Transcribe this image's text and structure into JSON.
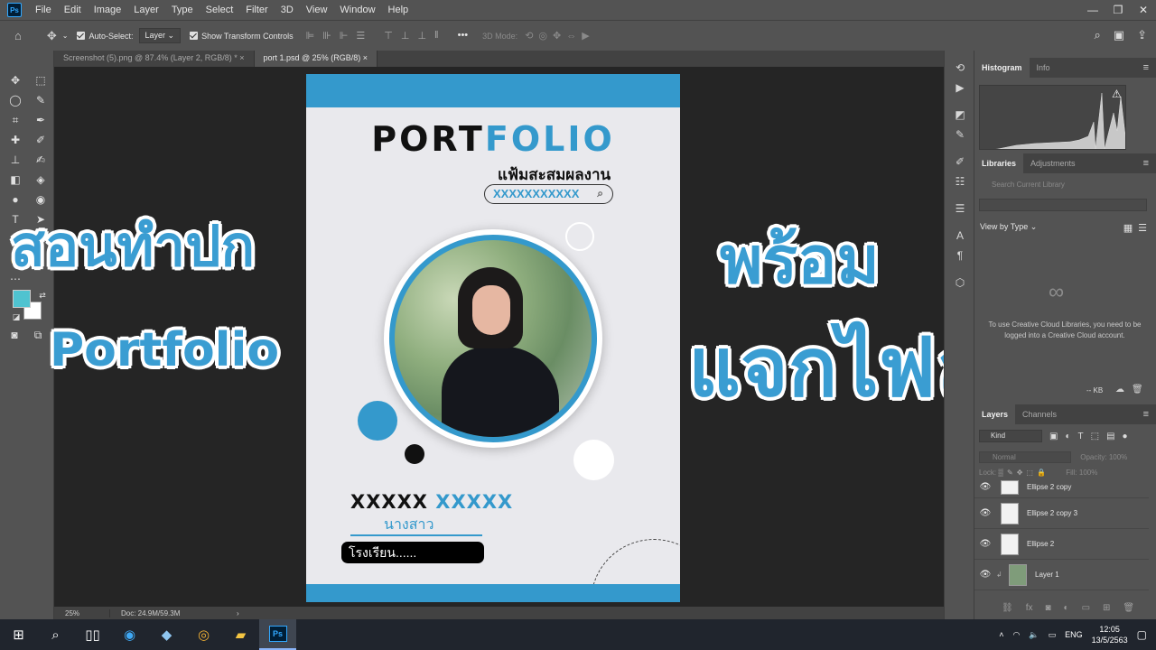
{
  "app": {
    "logo": "Ps"
  },
  "menu": [
    "File",
    "Edit",
    "Image",
    "Layer",
    "Type",
    "Select",
    "Filter",
    "3D",
    "View",
    "Window",
    "Help"
  ],
  "window_controls": {
    "minimize": "—",
    "restore": "❐",
    "close": "✕"
  },
  "options": {
    "auto_select_label": "Auto-Select:",
    "auto_select_value": "Layer",
    "transform_label": "Show Transform Controls",
    "mode3d_label": "3D Mode:"
  },
  "tabs": [
    {
      "label": "Screenshot (5).png @ 87.4% (Layer 2, RGB/8) *",
      "close": "×"
    },
    {
      "label": "port 1.psd @ 25% (RGB/8)",
      "close": "×"
    }
  ],
  "colors": {
    "foreground": "#4fc3d0",
    "background": "#ffffff",
    "accent": "#3499cc"
  },
  "document": {
    "title_part1": "PORT",
    "title_part2": "FOLIO",
    "subtitle": "แฟ้มสะสมผลงาน",
    "search_text": "XXXXXXXXXXX",
    "name_part1": "XXXXX",
    "name_part2": "XXXXX",
    "title_thai": "นางสาว",
    "school": "โรงเรียน......"
  },
  "overlay": {
    "line1": "สอนทำปก",
    "line2": "Portfolio",
    "line3": "พร้อม",
    "line4": "แจกไฟล์"
  },
  "status": {
    "zoom": "25%",
    "doc_size": "Doc: 24.9M/59.3M",
    "arrow": "›"
  },
  "panels": {
    "histogram_tabs": [
      "Histogram",
      "Info"
    ],
    "library_tabs": [
      "Libraries",
      "Adjustments"
    ],
    "library_search_placeholder": "Search Current Library",
    "view_by_type": "View by Type",
    "cc_message": "To use Creative Cloud Libraries, you need to be logged into a Creative Cloud account.",
    "kb_label": "-- KB",
    "layers_tabs": [
      "Layers",
      "Channels"
    ],
    "kind_label": "Kind",
    "blend_mode": "Normal",
    "opacity_label": "Opacity:",
    "opacity_value": "100%",
    "lock_label": "Lock:",
    "fill_label": "Fill:",
    "fill_value": "100%",
    "layers": [
      "Ellipse 2 copy",
      "Ellipse 2 copy 3",
      "Ellipse 2",
      "Layer 1"
    ]
  },
  "taskbar": {
    "language": "ENG",
    "time": "12:05",
    "date": "13/5/2563"
  }
}
